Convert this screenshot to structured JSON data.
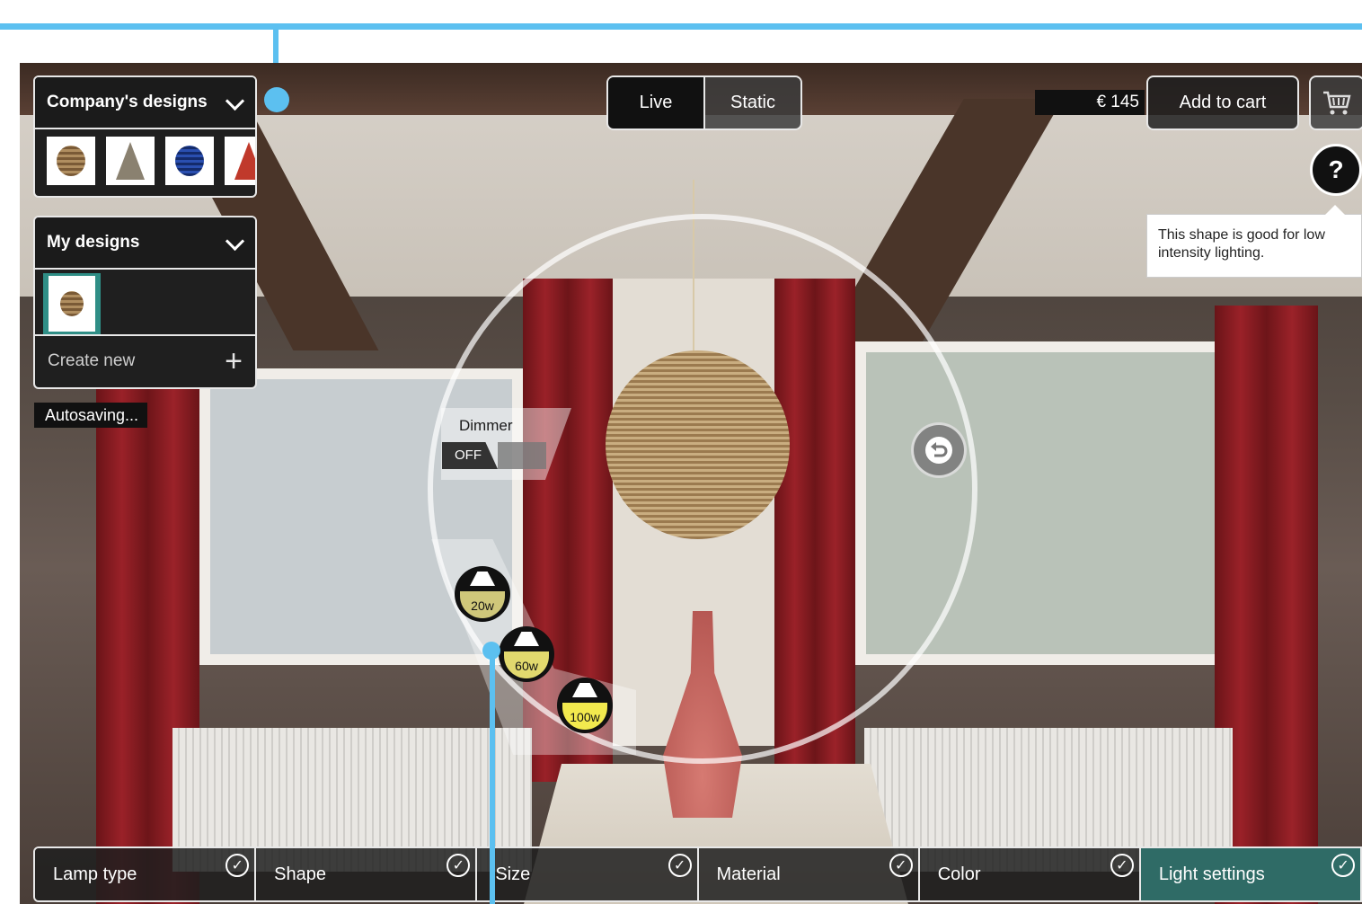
{
  "company_designs": {
    "title": "Company's designs",
    "thumbnails": [
      {
        "icon": "wicker-ball-lamp-icon",
        "color": "#8b6a44"
      },
      {
        "icon": "cone-lamp-icon",
        "color": "#8a8170"
      },
      {
        "icon": "blue-ball-lamp-icon",
        "color": "#1d3b8f"
      },
      {
        "icon": "red-lamp-icon",
        "color": "#c0392b"
      }
    ]
  },
  "my_designs": {
    "title": "My designs",
    "selected_thumbnail": {
      "icon": "wicker-ball-lamp-icon",
      "color": "#8b6a44"
    },
    "create_new_label": "Create new"
  },
  "status": {
    "autosave": "Autosaving..."
  },
  "view_toggle": {
    "live_label": "Live",
    "static_label": "Static",
    "selected": "Live"
  },
  "cart": {
    "price": "€ 145",
    "add_label": "Add to cart"
  },
  "help": {
    "icon_label": "?",
    "tooltip": "This shape is good for low intensity lighting."
  },
  "light_wheel": {
    "dimmer_label": "Dimmer",
    "dimmer_state": "OFF",
    "wattages": [
      "20w",
      "60w",
      "100w"
    ]
  },
  "steps": [
    {
      "label": "Lamp type",
      "done": true
    },
    {
      "label": "Shape",
      "done": true
    },
    {
      "label": "Size",
      "done": true
    },
    {
      "label": "Material",
      "done": true
    },
    {
      "label": "Color",
      "done": true
    },
    {
      "label": "Light settings",
      "done": true,
      "active": true
    }
  ],
  "colors": {
    "accent_blue": "#5cc0f0",
    "active_tab": "#2f6b66",
    "bulb_glow": "#e8e08a"
  }
}
